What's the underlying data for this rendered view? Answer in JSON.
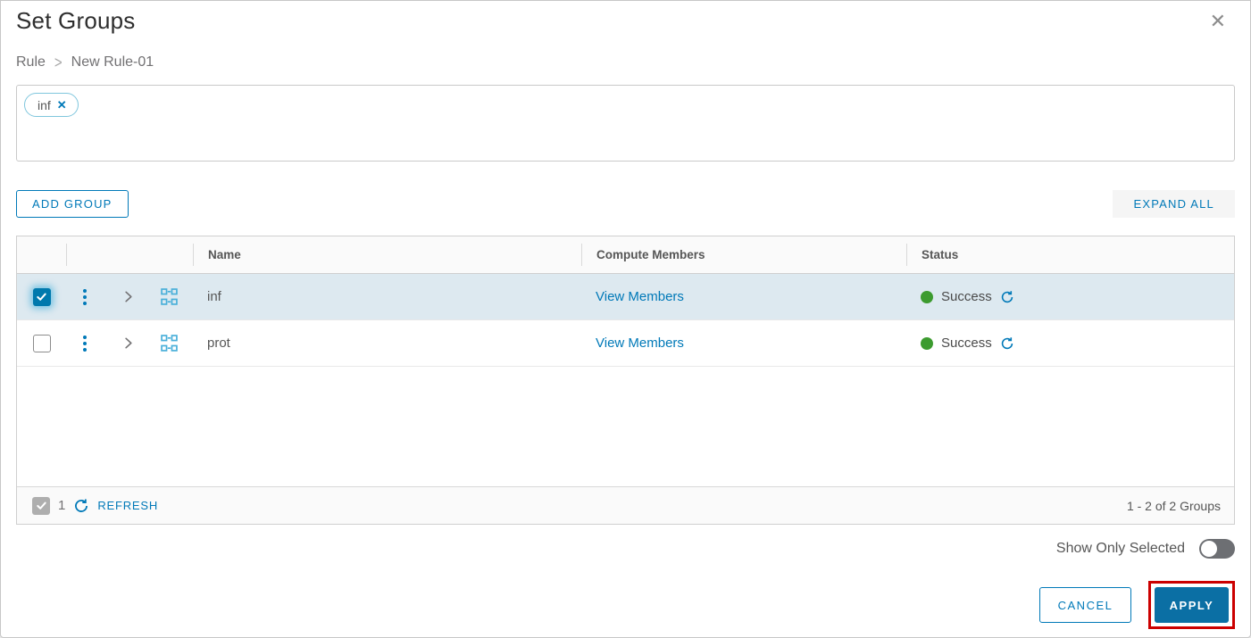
{
  "dialog": {
    "title": "Set Groups",
    "breadcrumb": {
      "parent": "Rule",
      "separator": ">",
      "current": "New Rule-01"
    },
    "selected_chips": [
      {
        "label": "inf"
      }
    ],
    "toolbar": {
      "add_group_label": "ADD GROUP",
      "expand_all_label": "EXPAND ALL"
    },
    "grid": {
      "columns": {
        "name": "Name",
        "compute_members": "Compute Members",
        "status": "Status"
      },
      "rows": [
        {
          "name": "inf",
          "compute_members_link": "View Members",
          "status": "Success",
          "selected": true
        },
        {
          "name": "prot",
          "compute_members_link": "View Members",
          "status": "Success",
          "selected": false
        }
      ],
      "footer": {
        "selected_count": "1",
        "refresh_label": "REFRESH",
        "range_label": "1 - 2 of 2 Groups"
      }
    },
    "show_only_selected_label": "Show Only Selected",
    "actions": {
      "cancel_label": "CANCEL",
      "apply_label": "APPLY"
    },
    "colors": {
      "accent_blue": "#0079b8",
      "primary_button_blue": "#0b6fa4",
      "success_green": "#3c9b2f",
      "selected_row_bg": "#dde9f0",
      "group_icon_cyan": "#49afd9",
      "annotation_red": "#cc0000"
    }
  }
}
